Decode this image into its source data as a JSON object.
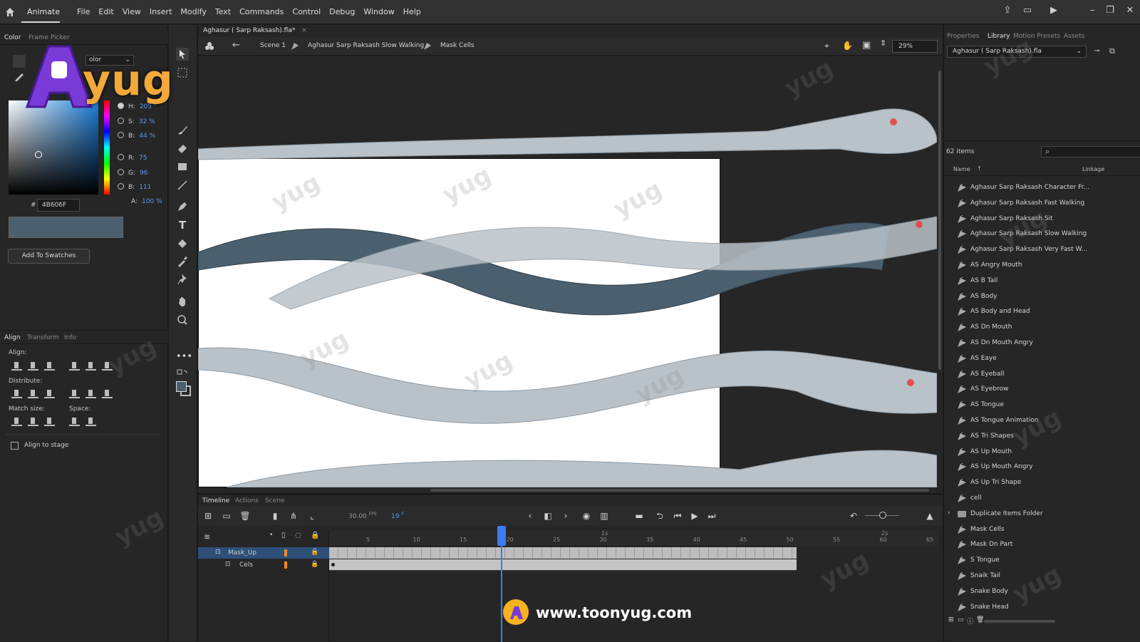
{
  "menubar": {
    "app_name": "Animate",
    "items": [
      "File",
      "Edit",
      "View",
      "Insert",
      "Modify",
      "Text",
      "Commands",
      "Control",
      "Debug",
      "Window",
      "Help"
    ]
  },
  "color_panel": {
    "tabs": [
      "Color",
      "Frame Picker"
    ],
    "color_type": "olor",
    "hsb": [
      {
        "label": "H:",
        "value": "205",
        "unit": "°"
      },
      {
        "label": "S:",
        "value": "32",
        "unit": "%"
      },
      {
        "label": "B:",
        "value": "44",
        "unit": "%"
      }
    ],
    "rgb": [
      {
        "label": "R:",
        "value": "75"
      },
      {
        "label": "G:",
        "value": "96"
      },
      {
        "label": "B:",
        "value": "111"
      }
    ],
    "alpha_label": "A:",
    "alpha_value": "100",
    "alpha_unit": "%",
    "hex_label": "#",
    "hex": "4B606F",
    "current_color": "#4b606f",
    "add_swatch": "Add To Swatches"
  },
  "align_panel": {
    "tabs": [
      "Align",
      "Transform",
      "Info"
    ],
    "align_label": "Align:",
    "distribute_label": "Distribute:",
    "match_size_label": "Match size:",
    "space_label": "Space:",
    "align_to_stage": "Align to stage"
  },
  "document": {
    "tab": "Aghasur ( Sarp Raksash).fla*",
    "breadcrumb": [
      "Scene 1",
      "Aghasur Sarp Raksash Slow Walking",
      "Mask Cells"
    ],
    "zoom": "29%"
  },
  "timeline": {
    "tabs": [
      "Timeline",
      "Actions",
      "Scene"
    ],
    "fps": "30.00",
    "fps_unit": "FPS",
    "current_frame": "19",
    "frame_unit": "F",
    "ruler_labels": [
      "5",
      "10",
      "15",
      "20",
      "25",
      "30",
      "35",
      "40",
      "45",
      "50",
      "55",
      "60",
      "65"
    ],
    "seconds_labels": [
      "1s",
      "2s"
    ],
    "layers": [
      {
        "name": "Mask_Up",
        "selected": true
      },
      {
        "name": "Cels",
        "selected": false
      }
    ]
  },
  "library": {
    "tabs": [
      "Properties",
      "Library",
      "Motion Presets",
      "Assets"
    ],
    "file": "Aghasur ( Sarp Raksash).fla",
    "item_count": "62 items",
    "col_name": "Name",
    "col_linkage": "Linkage",
    "items": [
      {
        "name": "Aghasur Sarp Raksash Character Fr...",
        "type": "symbol"
      },
      {
        "name": "Aghasur Sarp Raksash Fast Walking",
        "type": "symbol"
      },
      {
        "name": "Aghasur Sarp Raksash Sit",
        "type": "symbol"
      },
      {
        "name": "Aghasur Sarp Raksash Slow Walking",
        "type": "symbol"
      },
      {
        "name": "Aghasur Sarp Raksash Very Fast W...",
        "type": "symbol"
      },
      {
        "name": "AS Angry Mouth",
        "type": "symbol"
      },
      {
        "name": "AS B Tail",
        "type": "symbol"
      },
      {
        "name": "AS Body",
        "type": "symbol"
      },
      {
        "name": "AS Body and Head",
        "type": "symbol"
      },
      {
        "name": "AS Dn Mouth",
        "type": "symbol"
      },
      {
        "name": "AS Dn Mouth Angry",
        "type": "symbol"
      },
      {
        "name": "AS Eaye",
        "type": "symbol"
      },
      {
        "name": "AS Eyeball",
        "type": "symbol"
      },
      {
        "name": "AS Eyebrow",
        "type": "symbol"
      },
      {
        "name": "AS Tongue",
        "type": "symbol"
      },
      {
        "name": "AS Tongue Animation",
        "type": "symbol"
      },
      {
        "name": "AS Tri Shapes",
        "type": "symbol"
      },
      {
        "name": "AS Up Mouth",
        "type": "symbol"
      },
      {
        "name": "AS Up Mouth Angry",
        "type": "symbol"
      },
      {
        "name": "AS Up Tri Shape",
        "type": "symbol"
      },
      {
        "name": "cell",
        "type": "symbol"
      },
      {
        "name": "Duplicate Items Folder",
        "type": "folder"
      },
      {
        "name": "Mask Cells",
        "type": "symbol"
      },
      {
        "name": "Mask Dn Part",
        "type": "symbol"
      },
      {
        "name": "S Tongue",
        "type": "symbol"
      },
      {
        "name": "Snaik Tail",
        "type": "symbol"
      },
      {
        "name": "Snake Body",
        "type": "symbol"
      },
      {
        "name": "Snake Head",
        "type": "symbol"
      }
    ]
  },
  "overlay": {
    "brand": "yug",
    "website": "www.toonyug.com"
  }
}
